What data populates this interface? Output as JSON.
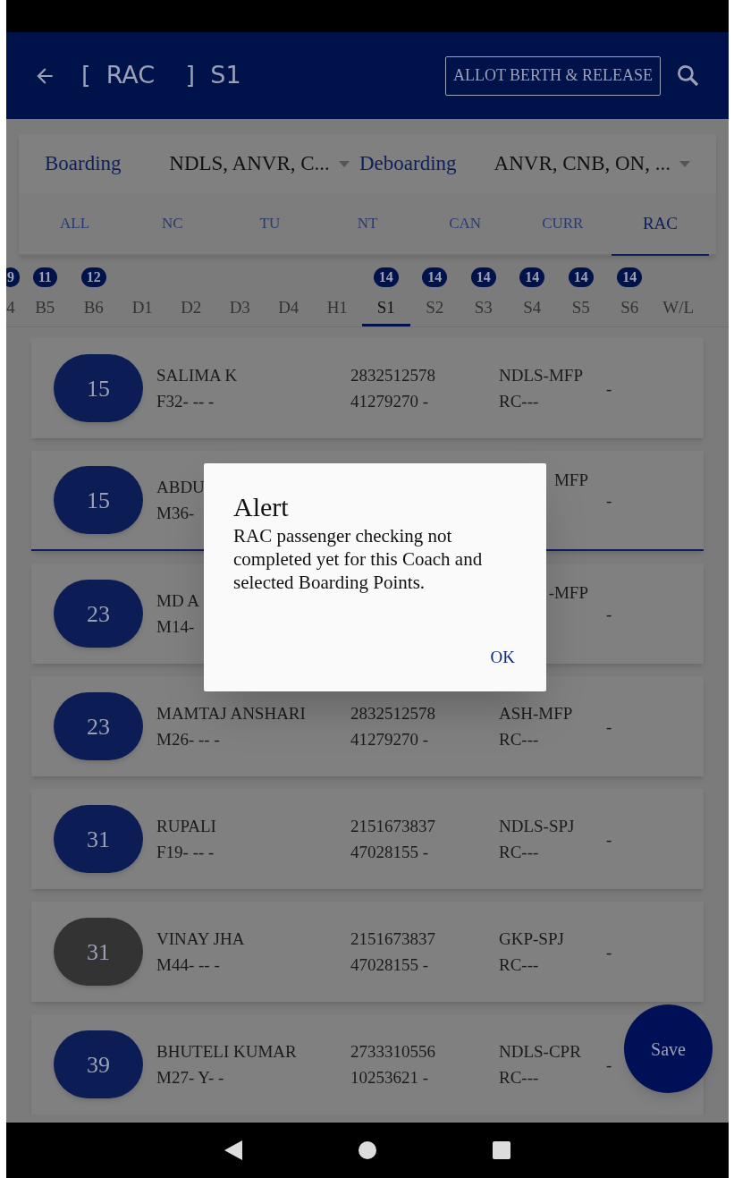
{
  "header": {
    "title": "[  RAC    ]  S1",
    "action_button": "ALLOT BERTH & RELEASE"
  },
  "filters": {
    "boarding_label": "Boarding",
    "boarding_value": "NDLS, ANVR, C...",
    "deboarding_label": "Deboarding",
    "deboarding_value": "ANVR, CNB, ON, ..."
  },
  "tabs": [
    {
      "label": "ALL",
      "selected": false
    },
    {
      "label": "NC",
      "selected": false
    },
    {
      "label": "TU",
      "selected": false
    },
    {
      "label": "NT",
      "selected": false
    },
    {
      "label": "CAN",
      "selected": false
    },
    {
      "label": "CURR",
      "selected": false
    },
    {
      "label": "RAC",
      "selected": true
    }
  ],
  "coaches": [
    {
      "label": "4",
      "count": "9",
      "selected": false
    },
    {
      "label": "B5",
      "count": "11",
      "selected": false
    },
    {
      "label": "B6",
      "count": "12",
      "selected": false
    },
    {
      "label": "D1",
      "selected": false
    },
    {
      "label": "D2",
      "selected": false
    },
    {
      "label": "D3",
      "selected": false
    },
    {
      "label": "D4",
      "selected": false
    },
    {
      "label": "H1",
      "selected": false
    },
    {
      "label": "S1",
      "count": "14",
      "selected": true
    },
    {
      "label": "S2",
      "count": "14",
      "selected": false
    },
    {
      "label": "S3",
      "count": "14",
      "selected": false
    },
    {
      "label": "S4",
      "count": "14",
      "selected": false
    },
    {
      "label": "S5",
      "count": "14",
      "selected": false
    },
    {
      "label": "S6",
      "count": "14",
      "selected": false
    },
    {
      "label": "W/L",
      "selected": false
    }
  ],
  "passengers": [
    {
      "berth": "15",
      "name": "SALIMA K",
      "info": "F32- -- -",
      "ticket": "2832512578",
      "pnr": "41279270 -",
      "route": "NDLS-MFP",
      "quota": "RC---",
      "extra": "-",
      "checked": false,
      "selected": false
    },
    {
      "berth": "15",
      "name": "ABDU",
      "info": "M36-",
      "route": "MFP",
      "extra": "-",
      "checked": false,
      "selected": true
    },
    {
      "berth": "23",
      "name": "MD A",
      "info": "M14-",
      "route": "-MFP",
      "extra": "-",
      "checked": false,
      "selected": false
    },
    {
      "berth": "23",
      "name": "MAMTAJ ANSHARI",
      "info": "M26- -- -",
      "ticket": "2832512578",
      "pnr": "41279270 -",
      "route": "ASH-MFP",
      "quota": "RC---",
      "extra": "-",
      "checked": false,
      "selected": false
    },
    {
      "berth": "31",
      "name": "RUPALI",
      "info": "F19- -- -",
      "ticket": "2151673837",
      "pnr": "47028155 -",
      "route": "NDLS-SPJ",
      "quota": "RC---",
      "extra": "-",
      "checked": false,
      "selected": false
    },
    {
      "berth": "31",
      "name": "VINAY JHA",
      "info": "M44- -- -",
      "ticket": "2151673837",
      "pnr": "47028155 -",
      "route": "GKP-SPJ",
      "quota": "RC---",
      "extra": "-",
      "checked": true,
      "selected": false
    },
    {
      "berth": "39",
      "name": "BHUTELI KUMAR",
      "info": "M27- Y- -",
      "ticket": "2733310556",
      "pnr": "10253621 -",
      "route": "NDLS-CPR",
      "quota": "RC---",
      "extra": "-",
      "checked": false,
      "selected": false
    }
  ],
  "save_button": "Save",
  "dialog": {
    "title": "Alert",
    "message": "RAC passenger checking not completed yet for this Coach and selected Boarding Points.",
    "ok": "OK"
  }
}
